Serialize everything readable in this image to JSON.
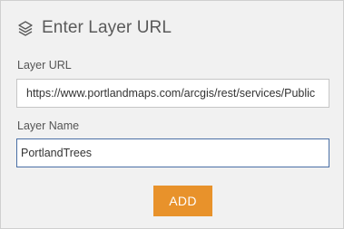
{
  "header": {
    "icon": "layers-icon",
    "title": "Enter Layer URL"
  },
  "form": {
    "url_label": "Layer URL",
    "url_value": "https://www.portlandmaps.com/arcgis/rest/services/Public",
    "name_label": "Layer Name",
    "name_value": "PortlandTrees"
  },
  "actions": {
    "add_label": "ADD"
  },
  "colors": {
    "panel_background": "#f1f1f1",
    "add_button": "#e8922b",
    "focused_border": "#4a6fa5"
  }
}
